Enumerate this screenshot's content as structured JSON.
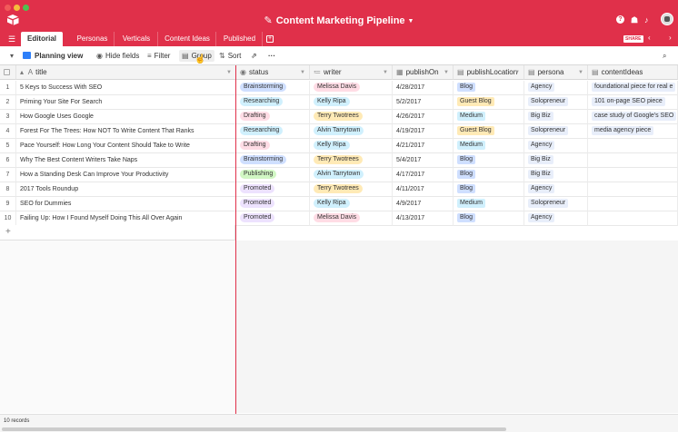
{
  "titlebar": {
    "title": "Content Marketing Pipeline",
    "accent": "#e0304a"
  },
  "tabs": [
    {
      "label": "Editorial",
      "active": true
    },
    {
      "label": "Personas"
    },
    {
      "label": "Verticals"
    },
    {
      "label": "Content Ideas"
    },
    {
      "label": "Published"
    }
  ],
  "share_label": "SHARE",
  "toolbar": {
    "view_label": "Planning view",
    "hide_fields": "Hide fields",
    "filter": "Filter",
    "group": "Group",
    "sort": "Sort"
  },
  "columns": [
    "title",
    "status",
    "writer",
    "publishOn",
    "publishLocation",
    "persona",
    "contentIdeas"
  ],
  "rows": [
    {
      "n": "1",
      "title": "5 Keys to Success With SEO",
      "status": "Brainstorming",
      "writer": "Melissa Davis",
      "date": "4/28/2017",
      "loc": "Blog",
      "persona": "Agency",
      "idea": "foundational piece for real e"
    },
    {
      "n": "2",
      "title": "Priming Your Site For Search",
      "status": "Researching",
      "writer": "Kelly Ripa",
      "date": "5/2/2017",
      "loc": "Guest Blog",
      "persona": "Solopreneur",
      "idea": "101 on-page SEO piece"
    },
    {
      "n": "3",
      "title": "How Google Uses Google",
      "status": "Drafting",
      "writer": "Terry Twotrees",
      "date": "4/26/2017",
      "loc": "Medium",
      "persona": "Big Biz",
      "idea": "case study of Google's SEO"
    },
    {
      "n": "4",
      "title": "Forest For The Trees: How NOT To Write Content That Ranks",
      "status": "Researching",
      "writer": "Alvin Tarrytown",
      "date": "4/19/2017",
      "loc": "Guest Blog",
      "persona": "Solopreneur",
      "idea": "media agency piece"
    },
    {
      "n": "5",
      "title": "Pace Yourself: How Long Your Content Should Take to Write",
      "status": "Drafting",
      "writer": "Kelly Ripa",
      "date": "4/21/2017",
      "loc": "Medium",
      "persona": "Agency",
      "idea": ""
    },
    {
      "n": "6",
      "title": "Why The Best Content Writers Take Naps",
      "status": "Brainstorming",
      "writer": "Terry Twotrees",
      "date": "5/4/2017",
      "loc": "Blog",
      "persona": "Big Biz",
      "idea": ""
    },
    {
      "n": "7",
      "title": "How a Standing Desk Can Improve Your Productivity",
      "status": "Publishing",
      "writer": "Alvin Tarrytown",
      "date": "4/17/2017",
      "loc": "Blog",
      "persona": "Big Biz",
      "idea": ""
    },
    {
      "n": "8",
      "title": "2017 Tools Roundup",
      "status": "Promoted",
      "writer": "Terry Twotrees",
      "date": "4/11/2017",
      "loc": "Blog",
      "persona": "Agency",
      "idea": ""
    },
    {
      "n": "9",
      "title": "SEO for Dummies",
      "status": "Promoted",
      "writer": "Kelly Ripa",
      "date": "4/9/2017",
      "loc": "Medium",
      "persona": "Solopreneur",
      "idea": ""
    },
    {
      "n": "10",
      "title": "Failing Up: How I Found Myself Doing This All Over Again",
      "status": "Promoted",
      "writer": "Melissa Davis",
      "date": "4/13/2017",
      "loc": "Blog",
      "persona": "Agency",
      "idea": ""
    }
  ],
  "status_colors": {
    "Brainstorming": "#cfdfff",
    "Researching": "#d0f0fd",
    "Drafting": "#ffdce5",
    "Publishing": "#d1f7c4",
    "Promoted": "#ede2fe"
  },
  "writer_colors": {
    "Melissa Davis": "#ffdce5",
    "Kelly Ripa": "#d0f0fd",
    "Terry Twotrees": "#ffeab6",
    "Alvin Tarrytown": "#d0f0fd"
  },
  "loc_colors": {
    "Blog": "#cfdfff",
    "Guest Blog": "#ffeab6",
    "Medium": "#d0f0fd"
  },
  "persona_color": "#e8eefa",
  "idea_color": "#e8eefa",
  "footer": {
    "records": "10 records"
  }
}
